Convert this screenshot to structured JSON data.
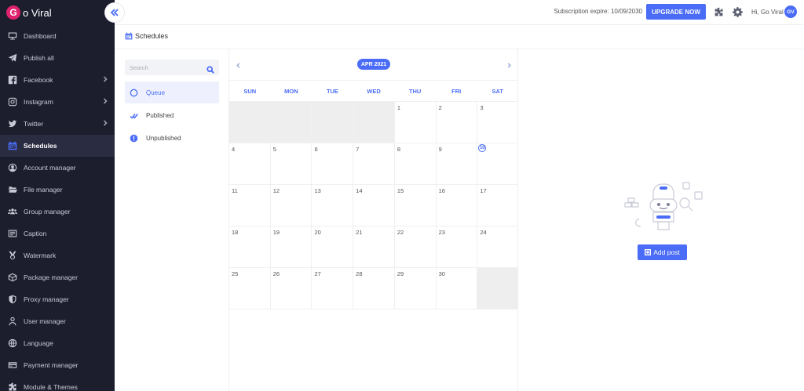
{
  "brand": {
    "logo_letter": "G",
    "name": "o Viral"
  },
  "sidebar": {
    "items": [
      {
        "label": "Dashboard",
        "icon": "monitor-icon",
        "chevron": false,
        "active": false
      },
      {
        "label": "Publish all",
        "icon": "paper-plane-icon",
        "chevron": false,
        "active": false
      },
      {
        "label": "Facebook",
        "icon": "facebook-icon",
        "chevron": true,
        "active": false
      },
      {
        "label": "Instagram",
        "icon": "instagram-icon",
        "chevron": true,
        "active": false
      },
      {
        "label": "Twitter",
        "icon": "twitter-icon",
        "chevron": true,
        "active": false
      },
      {
        "label": "Schedules",
        "icon": "calendar-icon",
        "chevron": false,
        "active": true
      },
      {
        "label": "Account manager",
        "icon": "user-circle-icon",
        "chevron": false,
        "active": false
      },
      {
        "label": "File manager",
        "icon": "folder-open-icon",
        "chevron": false,
        "active": false
      },
      {
        "label": "Group manager",
        "icon": "users-icon",
        "chevron": false,
        "active": false
      },
      {
        "label": "Caption",
        "icon": "caption-icon",
        "chevron": false,
        "active": false
      },
      {
        "label": "Watermark",
        "icon": "medal-icon",
        "chevron": false,
        "active": false
      },
      {
        "label": "Package manager",
        "icon": "box-icon",
        "chevron": false,
        "active": false
      },
      {
        "label": "Proxy manager",
        "icon": "shield-icon",
        "chevron": false,
        "active": false
      },
      {
        "label": "User manager",
        "icon": "user-icon",
        "chevron": false,
        "active": false
      },
      {
        "label": "Language",
        "icon": "globe-icon",
        "chevron": false,
        "active": false
      },
      {
        "label": "Payment manager",
        "icon": "credit-card-icon",
        "chevron": false,
        "active": false
      },
      {
        "label": "Module & Themes",
        "icon": "puzzle-icon",
        "chevron": false,
        "active": false
      }
    ]
  },
  "header": {
    "subscription": "Subscription expire: 10/09/2030",
    "upgrade_label": "UPGRADE NOW",
    "greeting": "Hi, Go Viral",
    "avatar_initials": "GV"
  },
  "page": {
    "title": "Schedules"
  },
  "filter": {
    "search_placeholder": "Search",
    "search_value": "",
    "items": [
      {
        "label": "Queue",
        "icon": "circle-outline-icon",
        "active": true
      },
      {
        "label": "Published",
        "icon": "double-check-icon",
        "active": false
      },
      {
        "label": "Unpublished",
        "icon": "exclamation-circle-icon",
        "active": false
      }
    ]
  },
  "calendar": {
    "month_label": "APR 2021",
    "weekdays": [
      "SUN",
      "MON",
      "TUE",
      "WED",
      "THU",
      "FRI",
      "SAT"
    ],
    "today": "10",
    "weeks": [
      [
        "",
        "",
        "",
        "",
        "1",
        "2",
        "3"
      ],
      [
        "4",
        "5",
        "6",
        "7",
        "8",
        "9",
        "10"
      ],
      [
        "11",
        "12",
        "13",
        "14",
        "15",
        "16",
        "17"
      ],
      [
        "18",
        "19",
        "20",
        "21",
        "22",
        "23",
        "24"
      ],
      [
        "25",
        "26",
        "27",
        "28",
        "29",
        "30",
        ""
      ]
    ]
  },
  "empty_state": {
    "button_label": "Add post"
  },
  "colors": {
    "accent": "#4a6cf7",
    "sidebar_bg": "#1c1e2d",
    "brand": "#e0226e",
    "blank_day": "#eeeeef"
  }
}
